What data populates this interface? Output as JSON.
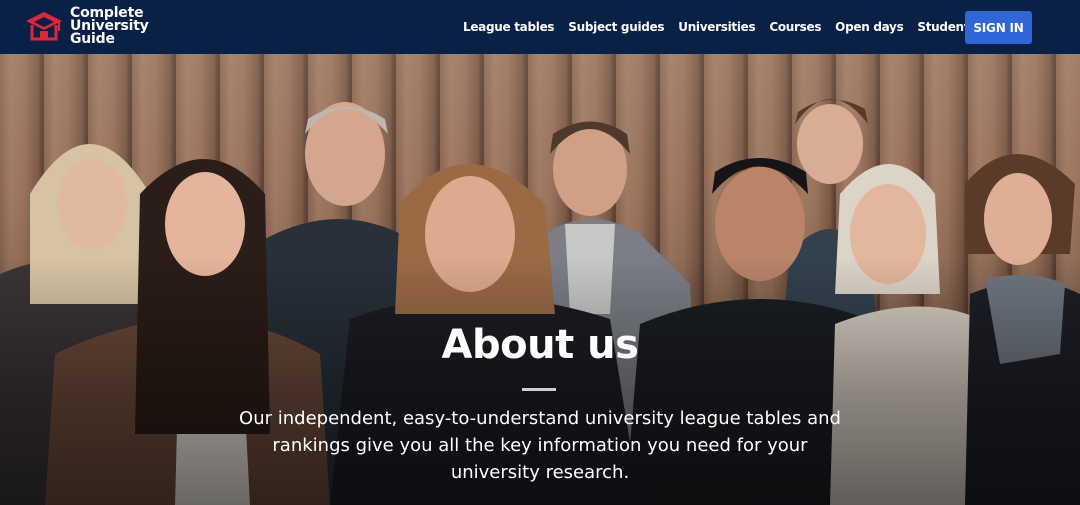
{
  "brand": {
    "name_line1": "Complete",
    "name_line2": "University",
    "name_line3": "Guide",
    "logo_icon": "graduation-cap-house-icon",
    "color_primary": "#0a2147",
    "color_accent": "#e0263b"
  },
  "nav": {
    "items": [
      {
        "label": "League tables"
      },
      {
        "label": "Subject guides"
      },
      {
        "label": "Universities"
      },
      {
        "label": "Courses"
      },
      {
        "label": "Open days"
      },
      {
        "label": "Student advice"
      }
    ],
    "signin_label": "SIGN IN",
    "signin_color": "#2f67d8"
  },
  "hero": {
    "title": "About us",
    "text": "Our independent, easy-to-understand university league tables and rankings give you all the key information you need for your university research.",
    "image": "team-photo"
  }
}
